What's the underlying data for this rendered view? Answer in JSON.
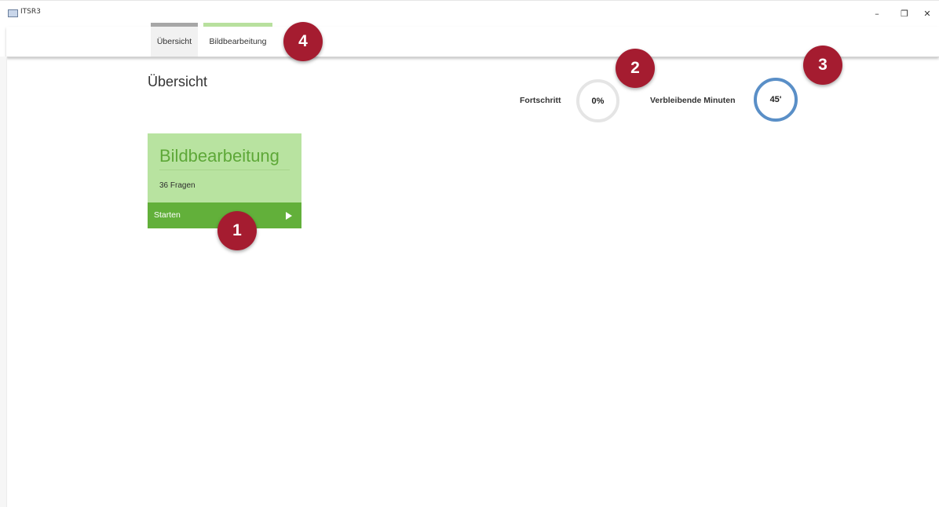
{
  "window": {
    "title": "ITSR3",
    "minimize_glyph": "–",
    "restore_glyph": "❐",
    "close_glyph": "✕"
  },
  "tabs": [
    {
      "label": "Übersicht",
      "accent": "#a7a7a7",
      "active": true
    },
    {
      "label": "Bildbearbeitung",
      "accent": "#b8e09e",
      "active": false
    }
  ],
  "page": {
    "title": "Übersicht"
  },
  "stats": {
    "progress_label": "Fortschritt",
    "progress_value": "0%",
    "minutes_label": "Verbleibende Minuten",
    "minutes_value": "45'"
  },
  "card": {
    "title": "Bildbearbeitung",
    "subtitle": "36 Fragen",
    "action_label": "Starten",
    "action_icon": "play-icon"
  },
  "callouts": [
    "1",
    "2",
    "3",
    "4"
  ],
  "colors": {
    "card_bg": "#b8e3a0",
    "card_footer": "#62b03a",
    "card_title": "#5ea838",
    "minutes_ring": "#5a8fc7",
    "progress_ring": "#e5e5e5",
    "callout": "#a51c30"
  }
}
